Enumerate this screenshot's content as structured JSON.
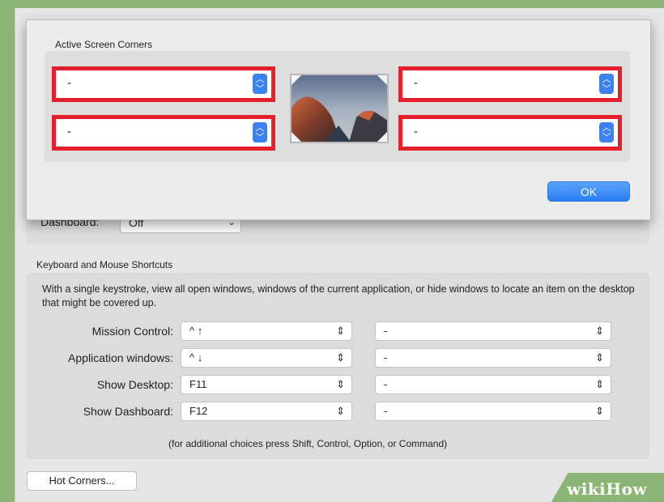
{
  "sheet": {
    "title": "Active Screen Corners",
    "corners": {
      "top_left": "-",
      "top_right": "-",
      "bottom_left": "-",
      "bottom_right": "-"
    },
    "ok_label": "OK"
  },
  "dashboard": {
    "label": "Dashboard:",
    "value": "Off"
  },
  "shortcuts": {
    "title": "Keyboard and Mouse Shortcuts",
    "description": "With a single keystroke, view all open windows, windows of the current application, or hide windows to locate an item on the desktop that might be covered up.",
    "rows": [
      {
        "label": "Mission Control:",
        "keyboard": "^ ↑",
        "mouse": "-"
      },
      {
        "label": "Application windows:",
        "keyboard": "^ ↓",
        "mouse": "-"
      },
      {
        "label": "Show Desktop:",
        "keyboard": "F11",
        "mouse": "-"
      },
      {
        "label": "Show Dashboard:",
        "keyboard": "F12",
        "mouse": "-"
      }
    ],
    "footnote": "(for additional choices press Shift, Control, Option, or Command)"
  },
  "hot_corners_label": "Hot Corners...",
  "watermark": {
    "part1": "wiki",
    "part2": "How"
  },
  "colors": {
    "highlight": "#e3202b",
    "accent": "#3b82f0",
    "background": "#8bb574"
  },
  "icons": {
    "stepper": "updown-chevron-icon",
    "dropdown": "chevron-down-icon"
  }
}
